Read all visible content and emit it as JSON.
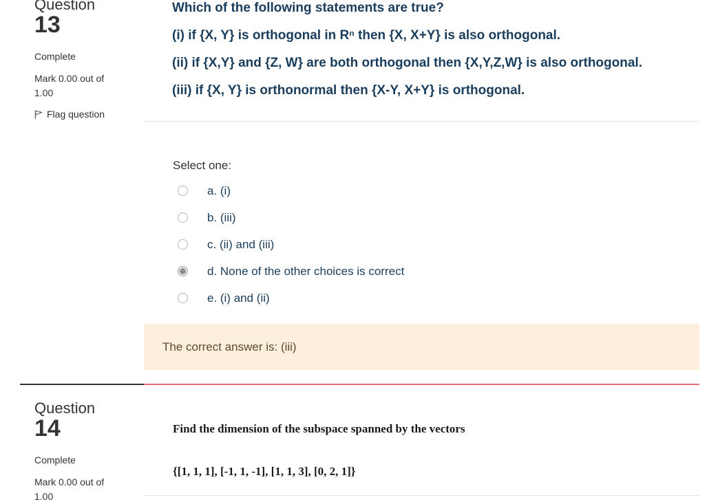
{
  "question13": {
    "label": "Question",
    "number": "13",
    "state": "Complete",
    "grade": "Mark 0.00 out of 1.00",
    "flag_label": "Flag question",
    "text": {
      "prompt": "Which of the following statements are true?",
      "s1": "(i) if {X, Y} is orthogonal in Rⁿ then {X, X+Y} is also orthogonal.",
      "s2": "(ii) if {X,Y} and {Z, W} are both orthogonal then {X,Y,Z,W} is also orthogonal.",
      "s3": "(iii) if {X, Y} is orthonormal then {X-Y, X+Y} is orthogonal."
    },
    "select_label": "Select one:",
    "options": [
      {
        "label": "a. (i)",
        "checked": false
      },
      {
        "label": "b. (iii)",
        "checked": false
      },
      {
        "label": "c. (ii) and (iii)",
        "checked": false
      },
      {
        "label": "d. None of the other choices is correct",
        "checked": true
      },
      {
        "label": "e. (i) and (ii)",
        "checked": false
      }
    ],
    "feedback": "The correct answer is: (iii)"
  },
  "question14": {
    "label": "Question",
    "number": "14",
    "state": "Complete",
    "grade": "Mark 0.00 out of 1.00",
    "text": "Find the dimension of the subspace spanned by the vectors",
    "vectors": "{[1, 1, 1], [-1, 1, -1], [1, 1, 3], [0, 2, 1]}"
  },
  "colors": {
    "question_text": "#1a3d5c",
    "feedback_bg": "#fcefdc",
    "incorrect_border": "#e26b72"
  },
  "icons": {
    "flag": "flag-icon",
    "radio": "radio-icon"
  }
}
